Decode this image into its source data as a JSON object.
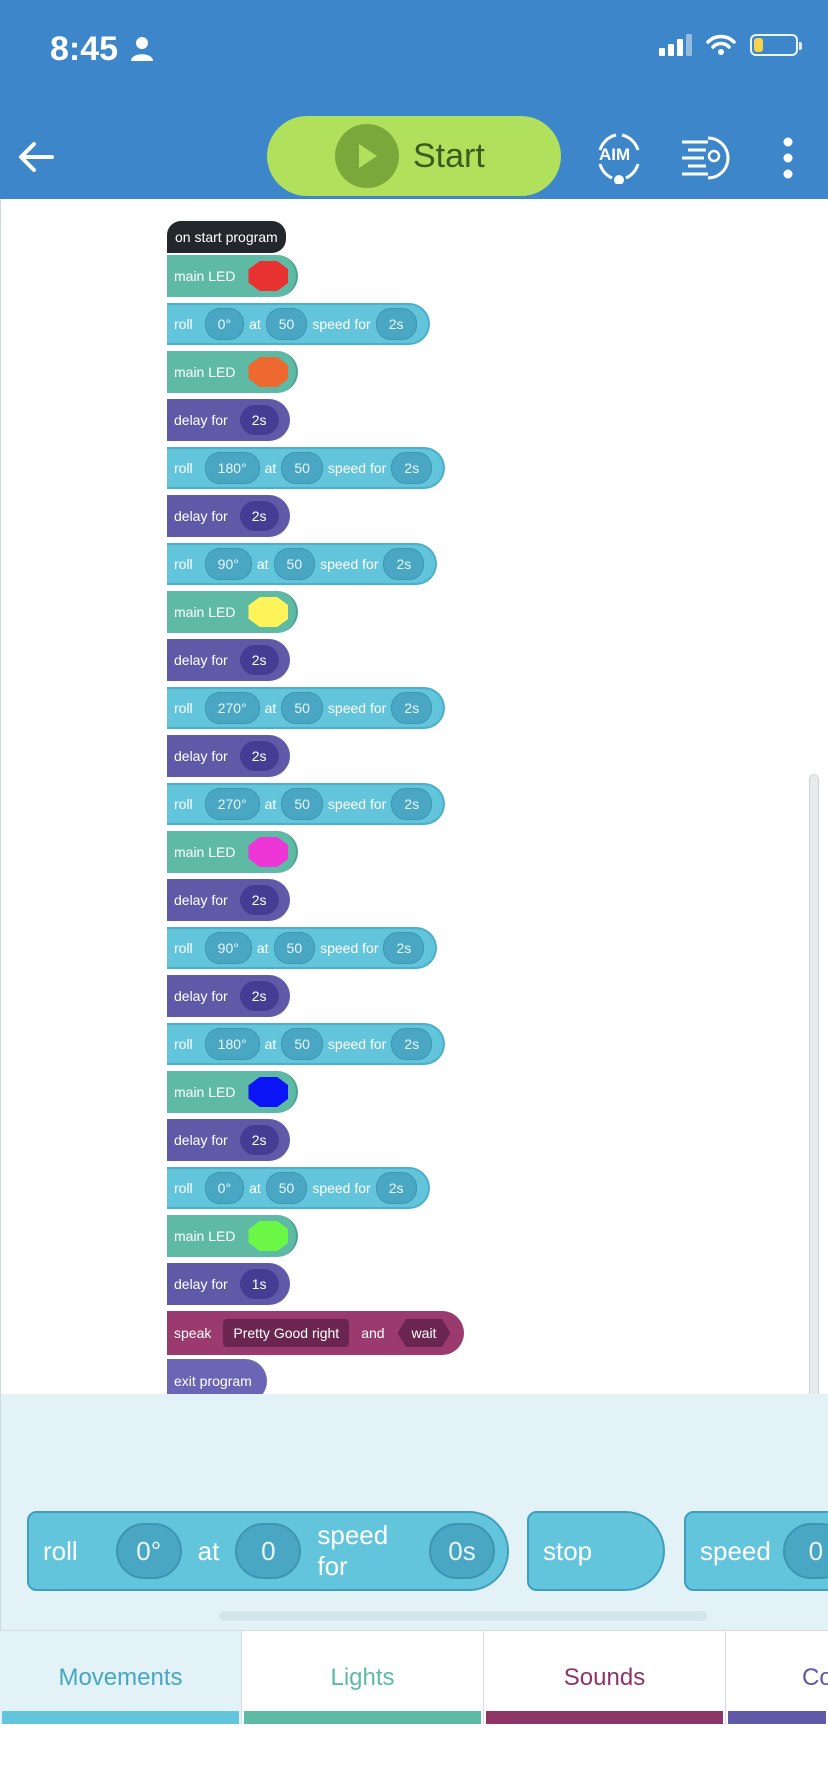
{
  "status_bar": {
    "time": "8:45"
  },
  "header": {
    "start_label": "Start",
    "aim_label": "AIM"
  },
  "program": {
    "start": "on start program",
    "led_label": "main LED",
    "roll_label": "roll",
    "at_label": "at",
    "speed_for_label": "speed for",
    "delay_label": "delay for",
    "blocks": [
      {
        "type": "led",
        "color": "#e83232"
      },
      {
        "type": "roll",
        "heading": "0°",
        "speed": "50",
        "duration": "2s"
      },
      {
        "type": "led",
        "color": "#ee6930"
      },
      {
        "type": "delay",
        "duration": "2s"
      },
      {
        "type": "roll",
        "heading": "180°",
        "speed": "50",
        "duration": "2s"
      },
      {
        "type": "delay",
        "duration": "2s"
      },
      {
        "type": "roll",
        "heading": "90°",
        "speed": "50",
        "duration": "2s"
      },
      {
        "type": "led",
        "color": "#fff35a"
      },
      {
        "type": "delay",
        "duration": "2s"
      },
      {
        "type": "roll",
        "heading": "270°",
        "speed": "50",
        "duration": "2s"
      },
      {
        "type": "delay",
        "duration": "2s"
      },
      {
        "type": "roll",
        "heading": "270°",
        "speed": "50",
        "duration": "2s"
      },
      {
        "type": "led",
        "color": "#ee35d5"
      },
      {
        "type": "delay",
        "duration": "2s"
      },
      {
        "type": "roll",
        "heading": "90°",
        "speed": "50",
        "duration": "2s"
      },
      {
        "type": "delay",
        "duration": "2s"
      },
      {
        "type": "roll",
        "heading": "180°",
        "speed": "50",
        "duration": "2s"
      },
      {
        "type": "led",
        "color": "#0a14f5"
      },
      {
        "type": "delay",
        "duration": "2s"
      },
      {
        "type": "roll",
        "heading": "0°",
        "speed": "50",
        "duration": "2s"
      },
      {
        "type": "led",
        "color": "#6cf747"
      },
      {
        "type": "delay",
        "duration": "1s"
      }
    ],
    "speak": {
      "label": "speak",
      "text": "Pretty Good right",
      "and": "and",
      "wait": "wait"
    },
    "exit": "exit program"
  },
  "palette": {
    "roll": {
      "label": "roll",
      "heading": "0°",
      "at": "at",
      "speed": "0",
      "speed_for": "speed for",
      "duration": "0s"
    },
    "stop": "stop",
    "speed": {
      "label": "speed",
      "value": "0"
    }
  },
  "tabs": [
    {
      "label": "Movements",
      "color": "#46a7c2",
      "bar": "#63c5dc",
      "active": true
    },
    {
      "label": "Lights",
      "color": "#5ebaa5",
      "bar": "#5ebaa5",
      "active": false
    },
    {
      "label": "Sounds",
      "color": "#8d3566",
      "bar": "#8d3566",
      "active": false
    },
    {
      "label": "Co",
      "color": "#5e5aa8",
      "bar": "#5e5aa8",
      "active": false
    }
  ]
}
